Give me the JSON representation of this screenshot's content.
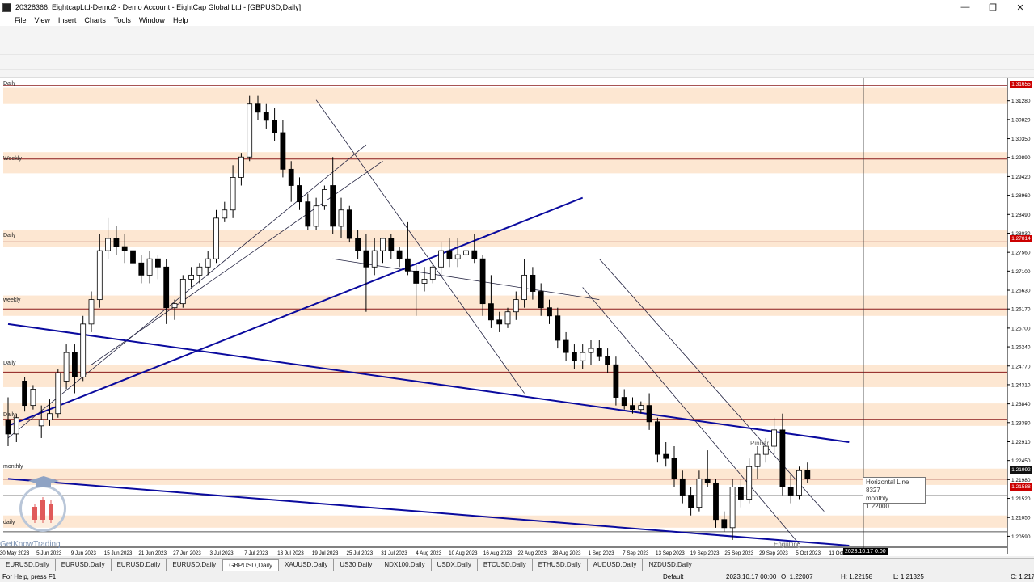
{
  "window": {
    "title": "20328366: EightcapLtd-Demo2 - Demo Account - EightCap Global Ltd - [GBPUSD,Daily]",
    "minimize": "—",
    "restore": "❐",
    "close": "✕"
  },
  "menu": [
    "File",
    "View",
    "Insert",
    "Charts",
    "Tools",
    "Window",
    "Help"
  ],
  "chart": {
    "left_labels": {
      "daily_top": "Daily",
      "weekly_1": "Weekly",
      "daily_2": "Daily",
      "weekly_2": "weekly",
      "daily_3": "Daily",
      "daily_4": "Daily",
      "monthly": "monthly",
      "daily_5": "daily"
    },
    "annotation_pinbar": "Pinbar",
    "annotation_engulfing": "Engulfing",
    "cursor_time": "2023.10.17 0:00",
    "price_tags": {
      "top": "1.31655",
      "mid": "1.27814",
      "bid": "1.21992",
      "ask": "1.21588"
    },
    "tooltip": {
      "line1": "Horizontal Line 8327",
      "line2": "monthly",
      "line3": "1.22000"
    },
    "watermark_text": "GetKnowTrading"
  },
  "colors": {
    "zone": "#fde7d2",
    "level_line": "#8b1a1a",
    "trend_blue": "#0a0a9e",
    "candle_bear": "#000000",
    "candle_bull": "#ffffff"
  },
  "chart_data": {
    "type": "candlestick",
    "symbol": "GBPUSD",
    "timeframe": "Daily",
    "y_ticks": [
      "1.31280",
      "1.30820",
      "1.30350",
      "1.29890",
      "1.29420",
      "1.28960",
      "1.28490",
      "1.28030",
      "1.27560",
      "1.27100",
      "1.26630",
      "1.26170",
      "1.25700",
      "1.25240",
      "1.24770",
      "1.24310",
      "1.23840",
      "1.23380",
      "1.22910",
      "1.22450",
      "1.21980",
      "1.21520",
      "1.21050",
      "1.20590"
    ],
    "x_ticks": [
      "30 May 2023",
      "5 Jun 2023",
      "9 Jun 2023",
      "15 Jun 2023",
      "21 Jun 2023",
      "27 Jun 2023",
      "3 Jul 2023",
      "7 Jul 2023",
      "13 Jul 2023",
      "19 Jul 2023",
      "25 Jul 2023",
      "31 Jul 2023",
      "4 Aug 2023",
      "10 Aug 2023",
      "16 Aug 2023",
      "22 Aug 2023",
      "28 Aug 2023",
      "1 Sep 2023",
      "7 Sep 2023",
      "13 Sep 2023",
      "19 Sep 2023",
      "25 Sep 2023",
      "29 Sep 2023",
      "5 Oct 2023",
      "11 Oct 2023",
      "2023"
    ],
    "ylim": [
      1.2036,
      1.3175
    ],
    "levels": [
      1.31655,
      1.2985,
      1.27814,
      1.2617,
      1.2462,
      1.2346,
      1.21992,
      1.21588,
      1.207
    ],
    "zones": [
      [
        1.312,
        1.316
      ],
      [
        1.295,
        1.3002
      ],
      [
        1.277,
        1.281
      ],
      [
        1.26,
        1.265
      ],
      [
        1.2425,
        1.248
      ],
      [
        1.233,
        1.2385
      ],
      [
        1.2185,
        1.2225
      ],
      [
        1.208,
        1.211
      ]
    ],
    "candles": [
      [
        1.2345,
        1.24,
        1.228,
        1.231
      ],
      [
        1.231,
        1.236,
        1.229,
        1.235
      ],
      [
        1.244,
        1.245,
        1.2365,
        1.238
      ],
      [
        1.238,
        1.243,
        1.237,
        1.242
      ],
      [
        1.233,
        1.238,
        1.23,
        1.2345
      ],
      [
        1.2345,
        1.2395,
        1.233,
        1.236
      ],
      [
        1.236,
        1.247,
        1.235,
        1.246
      ],
      [
        1.244,
        1.253,
        1.242,
        1.251
      ],
      [
        1.251,
        1.253,
        1.241,
        1.245
      ],
      [
        1.245,
        1.26,
        1.244,
        1.258
      ],
      [
        1.258,
        1.266,
        1.256,
        1.264
      ],
      [
        1.264,
        1.28,
        1.262,
        1.276
      ],
      [
        1.276,
        1.284,
        1.274,
        1.279
      ],
      [
        1.279,
        1.282,
        1.275,
        1.277
      ],
      [
        1.277,
        1.28,
        1.273,
        1.276
      ],
      [
        1.276,
        1.283,
        1.27,
        1.273
      ],
      [
        1.273,
        1.275,
        1.268,
        1.27
      ],
      [
        1.27,
        1.276,
        1.268,
        1.274
      ],
      [
        1.274,
        1.275,
        1.269,
        1.272
      ],
      [
        1.272,
        1.274,
        1.258,
        1.262
      ],
      [
        1.262,
        1.264,
        1.259,
        1.263
      ],
      [
        1.263,
        1.27,
        1.262,
        1.269
      ],
      [
        1.269,
        1.272,
        1.267,
        1.27
      ],
      [
        1.27,
        1.273,
        1.268,
        1.272
      ],
      [
        1.272,
        1.276,
        1.27,
        1.274
      ],
      [
        1.274,
        1.286,
        1.273,
        1.284
      ],
      [
        1.284,
        1.288,
        1.283,
        1.286
      ],
      [
        1.286,
        1.297,
        1.284,
        1.294
      ],
      [
        1.294,
        1.3,
        1.292,
        1.299
      ],
      [
        1.299,
        1.314,
        1.298,
        1.312
      ],
      [
        1.312,
        1.314,
        1.308,
        1.31
      ],
      [
        1.31,
        1.312,
        1.306,
        1.308
      ],
      [
        1.308,
        1.311,
        1.303,
        1.305
      ],
      [
        1.305,
        1.308,
        1.294,
        1.296
      ],
      [
        1.296,
        1.298,
        1.288,
        1.292
      ],
      [
        1.292,
        1.294,
        1.286,
        1.288
      ],
      [
        1.288,
        1.29,
        1.281,
        1.282
      ],
      [
        1.282,
        1.289,
        1.281,
        1.287
      ],
      [
        1.287,
        1.292,
        1.286,
        1.291
      ],
      [
        1.292,
        1.299,
        1.28,
        1.282
      ],
      [
        1.282,
        1.289,
        1.279,
        1.286
      ],
      [
        1.286,
        1.287,
        1.278,
        1.279
      ],
      [
        1.279,
        1.281,
        1.274,
        1.276
      ],
      [
        1.276,
        1.28,
        1.261,
        1.272
      ],
      [
        1.272,
        1.279,
        1.27,
        1.276
      ],
      [
        1.276,
        1.279,
        1.273,
        1.279
      ],
      [
        1.279,
        1.28,
        1.274,
        1.276
      ],
      [
        1.276,
        1.277,
        1.272,
        1.274
      ],
      [
        1.274,
        1.283,
        1.27,
        1.271
      ],
      [
        1.271,
        1.273,
        1.26,
        1.268
      ],
      [
        1.268,
        1.272,
        1.266,
        1.269
      ],
      [
        1.269,
        1.273,
        1.268,
        1.272
      ],
      [
        1.272,
        1.278,
        1.27,
        1.276
      ],
      [
        1.276,
        1.279,
        1.272,
        1.274
      ],
      [
        1.274,
        1.279,
        1.272,
        1.275
      ],
      [
        1.275,
        1.278,
        1.273,
        1.276
      ],
      [
        1.276,
        1.28,
        1.273,
        1.274
      ],
      [
        1.274,
        1.275,
        1.26,
        1.263
      ],
      [
        1.263,
        1.27,
        1.257,
        1.259
      ],
      [
        1.259,
        1.261,
        1.256,
        1.258
      ],
      [
        1.258,
        1.262,
        1.257,
        1.261
      ],
      [
        1.261,
        1.266,
        1.259,
        1.264
      ],
      [
        1.264,
        1.274,
        1.262,
        1.27
      ],
      [
        1.27,
        1.272,
        1.264,
        1.266
      ],
      [
        1.266,
        1.268,
        1.26,
        1.262
      ],
      [
        1.262,
        1.264,
        1.258,
        1.26
      ],
      [
        1.26,
        1.262,
        1.252,
        1.254
      ],
      [
        1.254,
        1.256,
        1.249,
        1.251
      ],
      [
        1.251,
        1.253,
        1.247,
        1.249
      ],
      [
        1.249,
        1.253,
        1.247,
        1.251
      ],
      [
        1.251,
        1.254,
        1.248,
        1.252
      ],
      [
        1.252,
        1.254,
        1.249,
        1.25
      ],
      [
        1.25,
        1.252,
        1.246,
        1.248
      ],
      [
        1.248,
        1.25,
        1.238,
        1.24
      ],
      [
        1.24,
        1.242,
        1.237,
        1.238
      ],
      [
        1.238,
        1.24,
        1.236,
        1.237
      ],
      [
        1.237,
        1.239,
        1.236,
        1.238
      ],
      [
        1.238,
        1.241,
        1.232,
        1.234
      ],
      [
        1.234,
        1.235,
        1.224,
        1.226
      ],
      [
        1.226,
        1.229,
        1.223,
        1.225
      ],
      [
        1.225,
        1.228,
        1.218,
        1.22
      ],
      [
        1.22,
        1.222,
        1.214,
        1.216
      ],
      [
        1.216,
        1.218,
        1.211,
        1.213
      ],
      [
        1.213,
        1.222,
        1.212,
        1.22
      ],
      [
        1.22,
        1.227,
        1.218,
        1.219
      ],
      [
        1.219,
        1.22,
        1.208,
        1.21
      ],
      [
        1.21,
        1.212,
        1.207,
        1.208
      ],
      [
        1.208,
        1.22,
        1.205,
        1.218
      ],
      [
        1.218,
        1.22,
        1.213,
        1.215
      ],
      [
        1.215,
        1.225,
        1.214,
        1.223
      ],
      [
        1.223,
        1.228,
        1.22,
        1.226
      ],
      [
        1.226,
        1.23,
        1.224,
        1.228
      ],
      [
        1.228,
        1.235,
        1.226,
        1.232
      ],
      [
        1.232,
        1.236,
        1.216,
        1.218
      ],
      [
        1.218,
        1.221,
        1.214,
        1.216
      ],
      [
        1.216,
        1.223,
        1.215,
        1.222
      ],
      [
        1.222,
        1.224,
        1.219,
        1.22
      ]
    ],
    "trendlines": [
      {
        "style": "thin",
        "points": [
          [
            0,
            1.23
          ],
          [
            43,
            1.302
          ]
        ]
      },
      {
        "style": "thin",
        "points": [
          [
            10,
            1.248
          ],
          [
            45,
            1.298
          ]
        ]
      },
      {
        "style": "thin",
        "points": [
          [
            37,
            1.313
          ],
          [
            62,
            1.241
          ]
        ]
      },
      {
        "style": "thin",
        "points": [
          [
            39,
            1.274
          ],
          [
            71,
            1.264
          ]
        ]
      },
      {
        "style": "thin",
        "points": [
          [
            71,
            1.274
          ],
          [
            98,
            1.212
          ]
        ]
      },
      {
        "style": "thin",
        "points": [
          [
            69,
            1.267
          ],
          [
            95,
            1.204
          ]
        ]
      },
      {
        "style": "thick",
        "points": [
          [
            0,
            1.233
          ],
          [
            69,
            1.289
          ]
        ]
      },
      {
        "style": "thick",
        "points": [
          [
            0,
            1.258
          ],
          [
            101,
            1.229
          ]
        ]
      },
      {
        "style": "thick",
        "points": [
          [
            0,
            1.22
          ],
          [
            101,
            1.2036
          ]
        ]
      }
    ]
  },
  "tabs": [
    "EURUSD,Daily",
    "EURUSD,Daily",
    "EURUSD,Daily",
    "EURUSD,Daily",
    "GBPUSD,Daily",
    "XAUUSD,Daily",
    "US30,Daily",
    "NDX100,Daily",
    "USDX,Daily",
    "BTCUSD,Daily",
    "ETHUSD,Daily",
    "AUDUSD,Daily",
    "NZDUSD,Daily"
  ],
  "active_tab_index": 4,
  "status": {
    "help": "For Help, press F1",
    "profile": "Default",
    "time": "2023.10.17 00:00",
    "open": "O: 1.22007",
    "high": "H: 1.22158",
    "low": "L: 1.21325",
    "close": "C: 1.217"
  }
}
